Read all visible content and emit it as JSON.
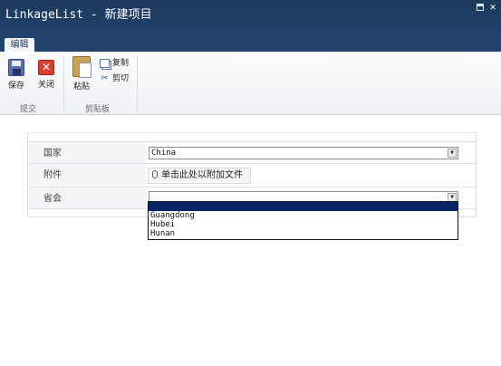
{
  "window": {
    "title": "LinkageList - 新建项目"
  },
  "tabs": [
    {
      "label": "编辑"
    }
  ],
  "ribbon": {
    "groups": [
      {
        "label": "提交",
        "buttons": [
          {
            "label": "保存",
            "icon": "save-icon"
          },
          {
            "label": "关闭",
            "icon": "close-icon"
          }
        ]
      },
      {
        "label": "剪贴板",
        "buttons": [
          {
            "label": "粘贴",
            "icon": "paste-icon"
          },
          {
            "label": "复制",
            "icon": "copy-icon"
          },
          {
            "label": "剪切",
            "icon": "cut-icon"
          }
        ]
      }
    ]
  },
  "form": {
    "fields": [
      {
        "label": "国家",
        "value": "China"
      },
      {
        "label": "附件",
        "action": "单击此处以附加文件"
      },
      {
        "label": "省会",
        "value": ""
      }
    ]
  },
  "dropdown": {
    "options": [
      "",
      "Guangdong",
      "Hubei",
      "Hunan"
    ]
  },
  "colors": {
    "titlebar": "#1d3a5c",
    "selection": "#0a246a",
    "close_red": "#d9412f"
  }
}
